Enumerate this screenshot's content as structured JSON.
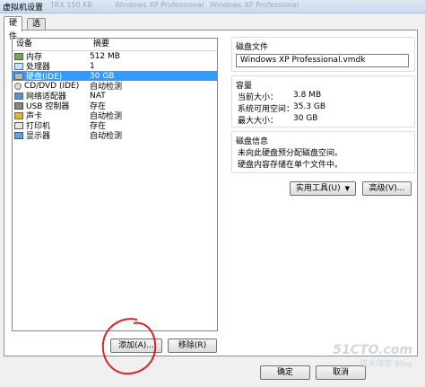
{
  "window": {
    "title": "虚拟机设置",
    "ghost_left": "TRX 150 KB",
    "ghost_mid": "Windows XP Professional",
    "ghost_right": "Windows XP Professional"
  },
  "tabs": [
    {
      "label": "硬件"
    },
    {
      "label": "选项"
    }
  ],
  "device_list": {
    "headers": {
      "device": "设备",
      "summary": "摘要"
    },
    "rows": [
      {
        "name": "内存",
        "summary": "512 MB",
        "icon": "memory-icon"
      },
      {
        "name": "处理器",
        "summary": "1",
        "icon": "processor-icon"
      },
      {
        "name": "硬盘(IDE)",
        "summary": "30 GB",
        "icon": "hard-disk-icon",
        "selected": true
      },
      {
        "name": "CD/DVD (IDE)",
        "summary": "自动检测",
        "icon": "cd-dvd-icon"
      },
      {
        "name": "网络适配器",
        "summary": "NAT",
        "icon": "network-adapter-icon"
      },
      {
        "name": "USB 控制器",
        "summary": "存在",
        "icon": "usb-icon"
      },
      {
        "name": "声卡",
        "summary": "自动检测",
        "icon": "sound-card-icon"
      },
      {
        "name": "打印机",
        "summary": "存在",
        "icon": "printer-icon"
      },
      {
        "name": "显示器",
        "summary": "自动检测",
        "icon": "display-icon"
      }
    ]
  },
  "list_buttons": {
    "add": "添加(A)...",
    "remove": "移除(R)"
  },
  "disk_file": {
    "title": "磁盘文件",
    "value": "Windows XP Professional.vmdk"
  },
  "capacity": {
    "title": "容量",
    "current_label": "当前大小：",
    "current_value": "3.8 MB",
    "system_free_label": "系统可用空间：",
    "system_free_value": "35.3 GB",
    "max_label": "最大大小：",
    "max_value": "30 GB"
  },
  "disk_info": {
    "title": "磁盘信息",
    "line1": "未向此硬盘预分配磁盘空间。",
    "line2": "硬盘内容存储在单个文件中。"
  },
  "tools": {
    "utilities": "实用工具(U)",
    "advanced": "高级(V)..."
  },
  "footer": {
    "ok": "确定",
    "cancel": "取消"
  },
  "watermark": {
    "site": "51CTO.com",
    "sub": "技术博客 Blog"
  },
  "colors": {
    "selection": "#3399ff",
    "annotation": "#e02020"
  }
}
